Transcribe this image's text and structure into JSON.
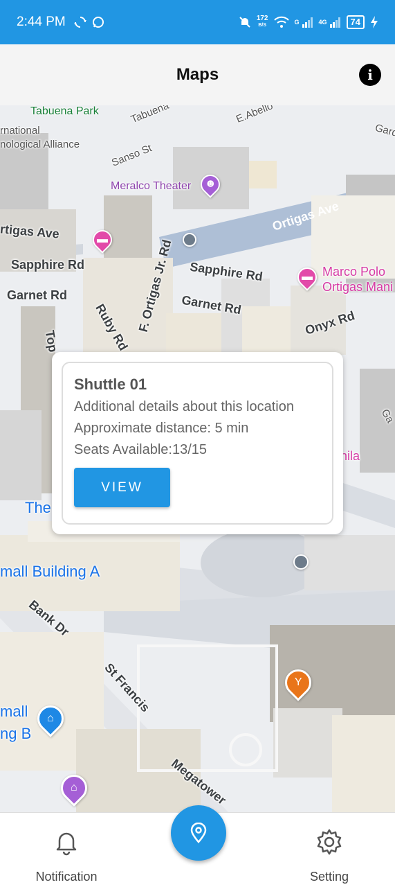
{
  "status_bar": {
    "time": "2:44 PM",
    "net_speed_value": "172",
    "net_speed_unit": "B/S",
    "sim1_label": "G",
    "sim2_label": "4G",
    "battery": "74"
  },
  "header": {
    "title": "Maps",
    "info_icon": "i"
  },
  "map": {
    "labels": {
      "tabuena_park": "Tabuena Park",
      "tabuena_st": "Tabuena",
      "e_abello": "E.Abello",
      "garden": "Gard",
      "intl_alliance_1": "rnational",
      "intl_alliance_2": "nological Alliance",
      "sanso_st": "Sanso St",
      "meralco_theater": "Meralco Theater",
      "ortigas_ave_left": "rtigas Ave",
      "ortigas_ave": "Ortigas Ave",
      "sapphire_rd_left": "Sapphire Rd",
      "sapphire_rd": "Sapphire Rd",
      "garnet_rd_left": "Garnet Rd",
      "garnet_rd": "Garnet Rd",
      "ruby_rd": "Ruby Rd",
      "f_ortigas_jr": "F. Ortigas Jr. Rd",
      "onyx_rd": "Onyx Rd",
      "marco_polo_1": "Marco Polo",
      "marco_polo_2": "Ortigas Mani",
      "topaz": "Top",
      "manila": "nila",
      "the": "The",
      "sm_building_a": "mall Building A",
      "bank_dr": "Bank Dr",
      "st_francis": "St Francis",
      "mall_b_1": "mall",
      "mall_b_2": "ng B",
      "megatower": "Megatower",
      "ga": "Ga"
    }
  },
  "info_window": {
    "title": "Shuttle 01",
    "details": "Additional details about this location",
    "distance": "Approximate distance: 5 min",
    "seats": "Seats Available:13/15",
    "view_label": "VIEW"
  },
  "bottom_nav": {
    "notification_label": "Notification",
    "setting_label": "Setting"
  },
  "colors": {
    "primary": "#2196e3",
    "header_bg": "#f4f4f4"
  }
}
